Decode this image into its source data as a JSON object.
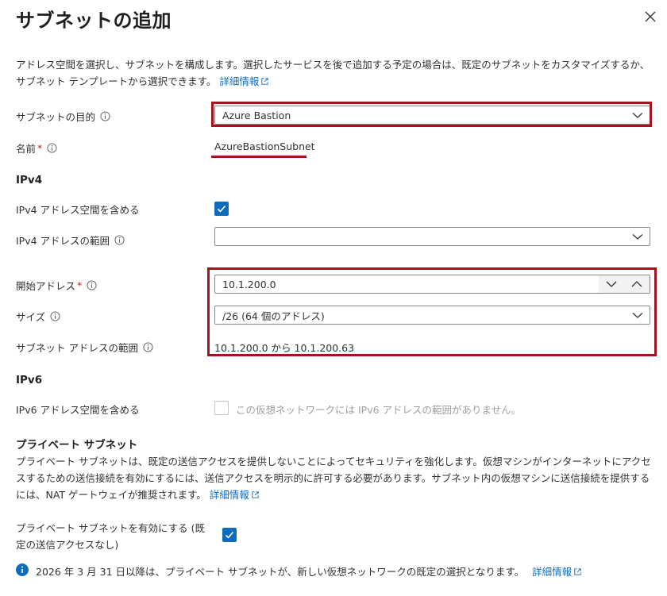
{
  "header": {
    "title": "サブネットの追加"
  },
  "intro": {
    "text": "アドレス空間を選択し、サブネットを構成します。選択したサービスを後で追加する予定の場合は、既定のサブネットをカスタマイズするか、サブネット テンプレートから選択できます。",
    "link": "詳細情報"
  },
  "purpose": {
    "label": "サブネットの目的",
    "value": "Azure Bastion"
  },
  "name": {
    "label": "名前",
    "required": "*",
    "value": "AzureBastionSubnet"
  },
  "ipv4": {
    "heading": "IPv4",
    "include_label": "IPv4 アドレス空間を含める",
    "include_checked": true,
    "range_label": "IPv4 アドレスの範囲",
    "range_value": "",
    "start_label": "開始アドレス",
    "start_required": "*",
    "start_value": "10.1.200.0",
    "size_label": "サイズ",
    "size_value": "/26 (64 個のアドレス)",
    "subnet_range_label": "サブネット アドレスの範囲",
    "subnet_range_value": "10.1.200.0 から 10.1.200.63"
  },
  "ipv6": {
    "heading": "IPv6",
    "include_label": "IPv6 アドレス空間を含める",
    "include_checked": false,
    "disabled_message": "この仮想ネットワークには IPv6 アドレスの範囲がありません。"
  },
  "private": {
    "heading": "プライベート サブネット",
    "text": "プライベート サブネットは、既定の送信アクセスを提供しないことによってセキュリティを強化します。仮想マシンがインターネットにアクセスするための送信接続を有効にするには、送信アクセスを明示的に許可する必要があります。サブネット内の仮想マシンに送信接続を提供するには、NAT ゲートウェイが推奨されます。",
    "link": "詳細情報",
    "enable_label_line1": "プライベート サブネットを有効にする (既",
    "enable_label_line2": "定の送信アクセスなし)",
    "enable_checked": true
  },
  "notice": {
    "text": "2026 年 3 月 31 日以降は、プライベート サブネットが、新しい仮想ネットワークの既定の選択となります。",
    "link": "詳細情報"
  },
  "colors": {
    "accent": "#0f6cbd",
    "highlight": "#a4141e",
    "info": "#0f6cbd"
  }
}
